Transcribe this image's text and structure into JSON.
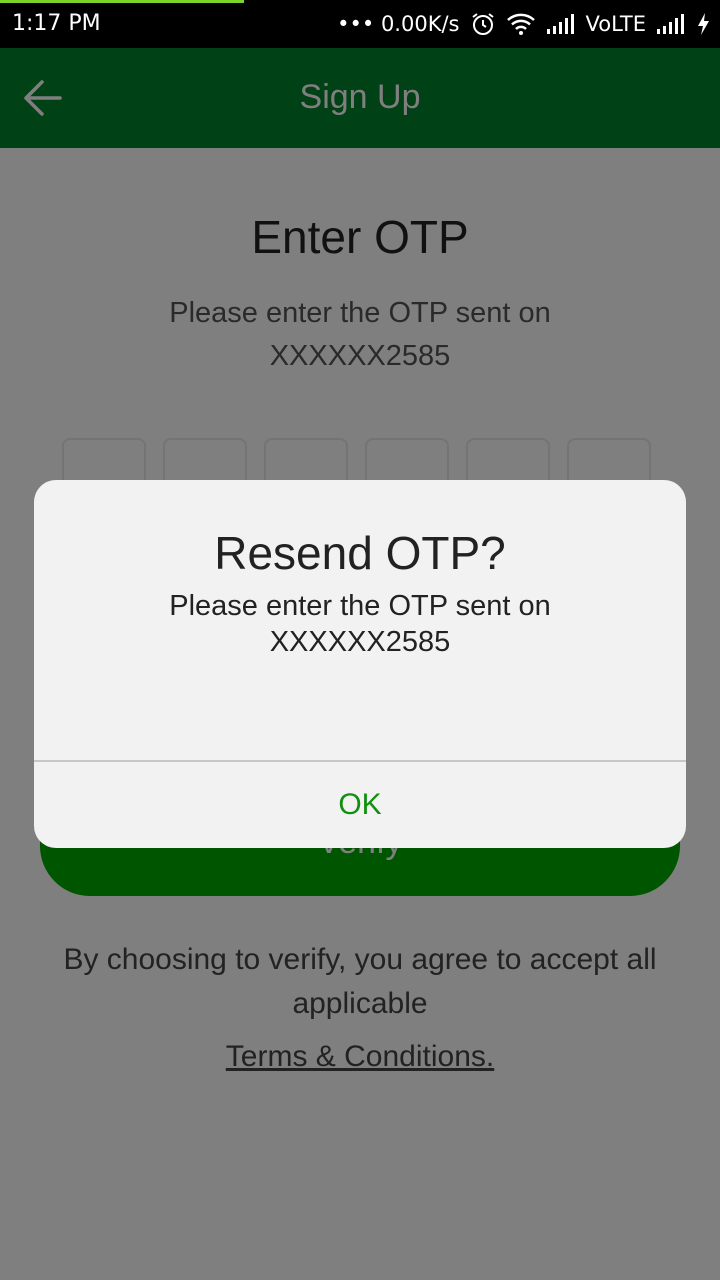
{
  "status_bar": {
    "time": "1:17 PM",
    "net_speed": "••• 0.00K/s",
    "network_label": "VoLTE",
    "icons": [
      "alarm-icon",
      "wifi-icon",
      "signal-icon",
      "charging-icon"
    ]
  },
  "app_bar": {
    "title": "Sign Up",
    "back_icon": "arrow-left-icon",
    "background": "#00822b"
  },
  "page": {
    "title": "Enter OTP",
    "subtitle_line1": "Please enter the OTP sent on",
    "subtitle_line2": "XXXXXX2585",
    "otp_digits": [
      "",
      "",
      "",
      "",
      "",
      ""
    ],
    "verify_label": "Verify",
    "terms_text": "By choosing to verify, you agree to accept all applicable",
    "terms_link": "Terms & Conditions."
  },
  "dialog": {
    "title": "Resend OTP?",
    "message_line1": "Please enter the OTP sent on",
    "message_line2": "XXXXXX2585",
    "ok_label": "OK",
    "accent": "#109010"
  }
}
